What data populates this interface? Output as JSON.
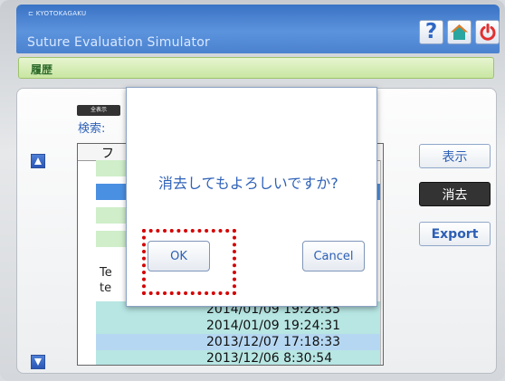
{
  "header": {
    "brand": "KYOTOKAGAKU",
    "title": "Suture Evaluation Simulator",
    "help_icon": "?"
  },
  "section": {
    "title": "履歴"
  },
  "left_panel": {
    "all_button": "全表示",
    "search_label": "検索:"
  },
  "table": {
    "header_fragment": "フ",
    "side_labels": [
      "Te",
      "te"
    ],
    "rows": [
      {
        "date": "2014/01/09 19:28:35"
      },
      {
        "date": "2014/01/09 19:24:31"
      },
      {
        "date": "2013/12/07 17:18:33"
      },
      {
        "date": "2013/12/06 8:30:54"
      }
    ]
  },
  "actions": {
    "show": "表示",
    "delete": "消去",
    "export": "Export"
  },
  "dialog": {
    "message": "消去してもよろしいですか?",
    "ok": "OK",
    "cancel": "Cancel"
  },
  "colors": {
    "header_blue": "#4b82cf",
    "section_green": "#c8e6a2",
    "highlight_red": "#d40000"
  }
}
